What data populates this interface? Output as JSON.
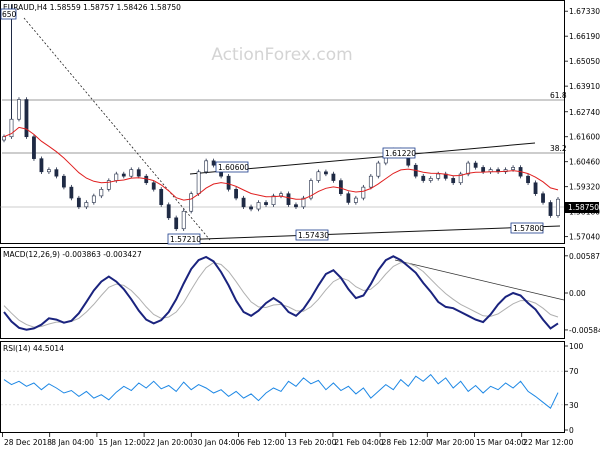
{
  "watermark": "ActionForex.com",
  "chart_data": [
    {
      "type": "candlestick",
      "title": "EURAUD,H4  1.58559 1.58757 1.58426 1.58750",
      "current_price_label": "1.58750",
      "y_ticks": [
        "1.67330",
        "1.66190",
        "1.65050",
        "1.63910",
        "1.62740",
        "1.61600",
        "1.60460",
        "1.59320",
        "1.58180",
        "1.57040"
      ],
      "ylim": [
        1.5675,
        1.6775
      ],
      "x_ticks": [
        "28 Dec 2018",
        "8 Jan 04:00",
        "15 Jan 12:00",
        "22 Jan 20:00",
        "30 Jan 04:00",
        "6 Feb 12:00",
        "13 Feb 20:00",
        "21 Feb 04:00",
        "28 Feb 12:00",
        "7 Mar 20:00",
        "15 Mar 04:00",
        "22 Mar 12:00"
      ],
      "annotations": [
        {
          "text": "650",
          "value": 1.6765
        },
        {
          "text": "1.60600",
          "value": 1.606
        },
        {
          "text": "1.61220",
          "value": 1.6122
        },
        {
          "text": "1.57210",
          "value": 1.5721
        },
        {
          "text": "1.57430",
          "value": 1.5743
        },
        {
          "text": "1.57800",
          "value": 1.578
        },
        {
          "text": "61.8",
          "value": 1.6339
        },
        {
          "text": "38.2",
          "value": 1.6135
        }
      ],
      "fib_levels": [
        1.6339,
        1.6135
      ],
      "close": [
        1.616,
        1.624,
        1.633,
        1.616,
        1.606,
        1.6,
        1.601,
        1.598,
        1.593,
        1.588,
        1.584,
        1.586,
        1.589,
        1.592,
        1.596,
        1.599,
        1.598,
        1.601,
        1.598,
        1.595,
        1.592,
        1.585,
        1.579,
        1.574,
        1.582,
        1.59,
        1.6,
        1.605,
        1.603,
        1.598,
        1.592,
        1.588,
        1.584,
        1.583,
        1.586,
        1.585,
        1.589,
        1.59,
        1.585,
        1.584,
        1.588,
        1.596,
        1.6,
        1.599,
        1.596,
        1.59,
        1.586,
        1.588,
        1.593,
        1.598,
        1.604,
        1.608,
        1.61,
        1.608,
        1.603,
        1.598,
        1.596,
        1.597,
        1.599,
        1.597,
        1.595,
        1.599,
        1.604,
        1.602,
        1.6,
        1.601,
        1.6,
        1.601,
        1.602,
        1.598,
        1.595,
        1.59,
        1.586,
        1.58,
        1.5875
      ]
    },
    {
      "type": "line",
      "title": "MACD(12,26,9) -0.003863 -0.003427",
      "y_ticks": [
        "0.005878",
        "0.00",
        "-0.005843"
      ],
      "ylim": [
        -0.0068,
        0.0068
      ],
      "series": [
        {
          "values": [
            -0.003,
            -0.0045,
            -0.0055,
            -0.0058,
            -0.0056,
            -0.005,
            -0.004,
            -0.0042,
            -0.0047,
            -0.0044,
            -0.0032,
            -0.0014,
            0.0004,
            0.0018,
            0.0026,
            0.0018,
            0.0006,
            -0.001,
            -0.0028,
            -0.0042,
            -0.0048,
            -0.0043,
            -0.003,
            -0.001,
            0.0015,
            0.0038,
            0.0052,
            0.0057,
            0.005,
            0.0033,
            0.0012,
            -0.0012,
            -0.003,
            -0.0036,
            -0.0028,
            -0.0016,
            -0.0008,
            -0.0016,
            -0.003,
            -0.0036,
            -0.0025,
            -0.0008,
            0.0012,
            0.003,
            0.0036,
            0.0024,
            0.0006,
            -0.0008,
            -0.0004,
            0.0014,
            0.0036,
            0.0052,
            0.0058,
            0.0052,
            0.0042,
            0.0032,
            0.0016,
            0.0002,
            -0.0014,
            -0.0022,
            -0.0024,
            -0.003,
            -0.0036,
            -0.0042,
            -0.0046,
            -0.0034,
            -0.0018,
            -0.0006,
            0.0,
            -0.0004,
            -0.0016,
            -0.0026,
            -0.0042,
            -0.0056,
            -0.0048
          ]
        },
        {
          "values": [
            -0.002,
            -0.0032,
            -0.0043,
            -0.005,
            -0.0054,
            -0.0053,
            -0.0049,
            -0.0046,
            -0.0046,
            -0.0045,
            -0.004,
            -0.003,
            -0.0018,
            -0.0004,
            0.0009,
            0.0014,
            0.0012,
            0.0004,
            -0.0008,
            -0.0022,
            -0.0034,
            -0.004,
            -0.0038,
            -0.003,
            -0.0015,
            0.0005,
            0.0024,
            0.004,
            0.0048,
            0.0045,
            0.0034,
            0.0018,
            0.0001,
            -0.0014,
            -0.0022,
            -0.0023,
            -0.0019,
            -0.0018,
            -0.0022,
            -0.0028,
            -0.0029,
            -0.0022,
            -0.001,
            0.0005,
            0.0018,
            0.0024,
            0.002,
            0.001,
            0.0004,
            0.0006,
            0.0016,
            0.003,
            0.0042,
            0.0048,
            0.0047,
            0.0042,
            0.0034,
            0.0022,
            0.001,
            -0.0001,
            -0.001,
            -0.0018,
            -0.0024,
            -0.003,
            -0.0036,
            -0.0037,
            -0.0033,
            -0.0025,
            -0.0017,
            -0.0012,
            -0.0012,
            -0.0016,
            -0.0024,
            -0.0034,
            -0.0038
          ]
        }
      ]
    },
    {
      "type": "line",
      "title": "RSI(14) 44.5014",
      "y_ticks": [
        "100",
        "70",
        "30",
        "0"
      ],
      "ylim": [
        0,
        100
      ],
      "values": [
        60,
        54,
        58,
        52,
        56,
        48,
        55,
        50,
        44,
        47,
        40,
        46,
        38,
        42,
        36,
        45,
        52,
        47,
        56,
        50,
        58,
        49,
        53,
        46,
        57,
        48,
        54,
        50,
        44,
        48,
        40,
        46,
        38,
        43,
        35,
        44,
        50,
        46,
        58,
        52,
        62,
        55,
        59,
        48,
        56,
        47,
        52,
        43,
        50,
        38,
        46,
        54,
        48,
        60,
        52,
        64,
        58,
        66,
        55,
        62,
        50,
        58,
        46,
        53,
        44,
        52,
        48,
        56,
        50,
        58,
        46,
        40,
        33,
        26,
        44.5
      ]
    }
  ]
}
